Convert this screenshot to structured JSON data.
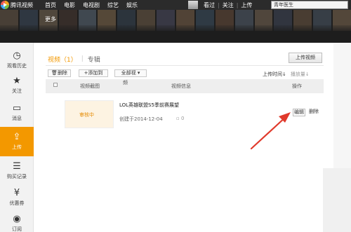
{
  "topbar": {
    "logo_text": "腾讯视频",
    "nav": [
      "首页",
      "电影",
      "电视剧",
      "综艺",
      "娱乐"
    ],
    "links": [
      "看过",
      "关注",
      "上传"
    ],
    "search_value": "青年医生"
  },
  "banner": {
    "more_label": "更多"
  },
  "sidebar": {
    "items": [
      {
        "label": "观看历史",
        "icon": "clock-icon",
        "glyph": "◷"
      },
      {
        "label": "关注",
        "icon": "star-icon",
        "glyph": "★"
      },
      {
        "label": "消息",
        "icon": "message-icon",
        "glyph": "▭"
      },
      {
        "label": "上传",
        "icon": "upload-icon",
        "glyph": "⇪"
      },
      {
        "label": "购买记录",
        "icon": "list-icon",
        "glyph": "☰"
      },
      {
        "label": "优惠券",
        "icon": "coupon-icon",
        "glyph": "¥"
      },
      {
        "label": "订阅",
        "icon": "rss-icon",
        "glyph": "◉"
      }
    ],
    "active_index": 3
  },
  "main": {
    "tab_video": "视频（1）",
    "tab_album": "专辑",
    "upload_button": "上传视频",
    "toolbar": {
      "delete": "删除",
      "add_to": "+添加到",
      "all_videos": "全部视",
      "sort_time": "上传时间",
      "sort_plays": "播放量"
    },
    "table": {
      "col_thumb": "视频截图",
      "col_frequency": "频",
      "col_info": "视频信息",
      "col_ops": "操作"
    },
    "row": {
      "status": "审核中",
      "title": "LOL英雄联盟S5季前赛展望",
      "created": "创建于2014-12-04",
      "comments": "0",
      "edit": "编辑",
      "delete": "删除"
    }
  },
  "colors": {
    "accent": "#f39800",
    "annotation_arrow": "#e03a2c",
    "topbar_bg": "#2b2b2b"
  }
}
